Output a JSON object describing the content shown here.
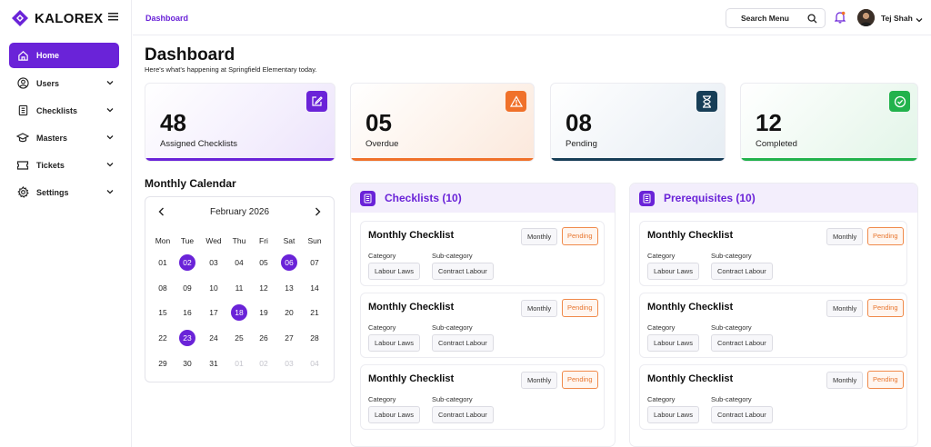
{
  "brand": {
    "name": "KALOREX",
    "accent": "#6a23d8"
  },
  "sidebar": {
    "items": [
      {
        "label": "Home",
        "icon": "home-icon",
        "active": true
      },
      {
        "label": "Users",
        "icon": "user-icon"
      },
      {
        "label": "Checklists",
        "icon": "checklist-icon"
      },
      {
        "label": "Masters",
        "icon": "graduation-cap-icon"
      },
      {
        "label": "Tickets",
        "icon": "ticket-icon"
      },
      {
        "label": "Settings",
        "icon": "gear-icon"
      }
    ]
  },
  "header": {
    "breadcrumb": "Dashboard",
    "search_label": "Search Menu",
    "user_name": "Tej Shah"
  },
  "page": {
    "title": "Dashboard",
    "subtitle": "Here's what's happening at Springfield Elementary today."
  },
  "stats": [
    {
      "value": "48",
      "label": "Assigned Checklists",
      "color": "#6a23d8",
      "icon": "edit-icon"
    },
    {
      "value": "05",
      "label": "Overdue",
      "color": "#f0712a",
      "icon": "warning-icon"
    },
    {
      "value": "08",
      "label": "Pending",
      "color": "#173e57",
      "icon": "hourglass-icon"
    },
    {
      "value": "12",
      "label": "Completed",
      "color": "#22b24c",
      "icon": "check-circle-icon"
    }
  ],
  "calendar": {
    "title": "Monthly Calendar",
    "month": "February 2026",
    "weekdays": [
      "Mon",
      "Tue",
      "Wed",
      "Thu",
      "Fri",
      "Sat",
      "Sun"
    ],
    "weeks": [
      [
        "01",
        "02",
        "03",
        "04",
        "05",
        "06",
        "07"
      ],
      [
        "08",
        "09",
        "10",
        "11",
        "12",
        "13",
        "14"
      ],
      [
        "15",
        "16",
        "17",
        "18",
        "19",
        "20",
        "21"
      ],
      [
        "22",
        "23",
        "24",
        "25",
        "26",
        "27",
        "28"
      ],
      [
        "29",
        "30",
        "31",
        "01",
        "02",
        "03",
        "04"
      ]
    ],
    "highlighted": [
      "02",
      "06",
      "18",
      "23"
    ]
  },
  "checklists": {
    "title": "Checklists (10)",
    "items": [
      {
        "title": "Monthly Checklist",
        "frequency": "Monthly",
        "status": "Pending",
        "category_label": "Category",
        "category": "Labour Laws",
        "subcategory_label": "Sub-category",
        "subcategory": "Contract Labour"
      },
      {
        "title": "Monthly Checklist",
        "frequency": "Monthly",
        "status": "Pending",
        "category_label": "Category",
        "category": "Labour Laws",
        "subcategory_label": "Sub-category",
        "subcategory": "Contract Labour"
      },
      {
        "title": "Monthly Checklist",
        "frequency": "Monthly",
        "status": "Pending",
        "category_label": "Category",
        "category": "Labour Laws",
        "subcategory_label": "Sub-category",
        "subcategory": "Contract Labour"
      }
    ]
  },
  "prerequisites": {
    "title": "Prerequisites (10)",
    "items": [
      {
        "title": "Monthly Checklist",
        "frequency": "Monthly",
        "status": "Pending",
        "category_label": "Category",
        "category": "Labour Laws",
        "subcategory_label": "Sub-category",
        "subcategory": "Contract Labour"
      },
      {
        "title": "Monthly Checklist",
        "frequency": "Monthly",
        "status": "Pending",
        "category_label": "Category",
        "category": "Labour Laws",
        "subcategory_label": "Sub-category",
        "subcategory": "Contract Labour"
      },
      {
        "title": "Monthly Checklist",
        "frequency": "Monthly",
        "status": "Pending",
        "category_label": "Category",
        "category": "Labour Laws",
        "subcategory_label": "Sub-category",
        "subcategory": "Contract Labour"
      }
    ]
  }
}
